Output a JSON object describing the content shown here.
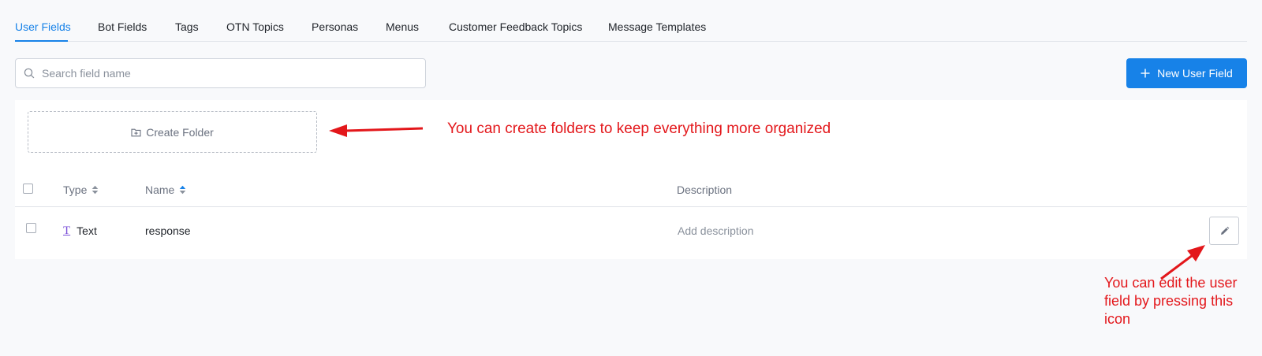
{
  "tabs": [
    {
      "label": "User Fields",
      "active": true
    },
    {
      "label": "Bot Fields",
      "active": false
    },
    {
      "label": "Tags",
      "active": false
    },
    {
      "label": "OTN Topics",
      "active": false
    },
    {
      "label": "Personas",
      "active": false
    },
    {
      "label": "Menus",
      "active": false
    },
    {
      "label": "Customer Feedback Topics",
      "active": false
    },
    {
      "label": "Message Templates",
      "active": false
    }
  ],
  "search": {
    "placeholder": "Search field name",
    "value": ""
  },
  "new_button": {
    "label": "New User Field"
  },
  "create_folder": {
    "label": "Create Folder"
  },
  "table": {
    "columns": {
      "type": "Type",
      "name": "Name",
      "description": "Description"
    },
    "rows": [
      {
        "type": "Text",
        "name": "response",
        "description": "Add description"
      }
    ]
  },
  "annotations": {
    "folders": "You can create folders to keep everything more organized",
    "edit": "You can edit the user field by pressing this icon"
  },
  "colors": {
    "accent": "#1782e8",
    "annotation": "#e3171b",
    "type_icon": "#7a4fd8"
  },
  "icons": {
    "search": "search-icon",
    "add": "plus-icon",
    "folder": "folder-add-icon",
    "sort": "sort-icon",
    "type": "text-type-icon",
    "edit": "pencil-icon"
  }
}
